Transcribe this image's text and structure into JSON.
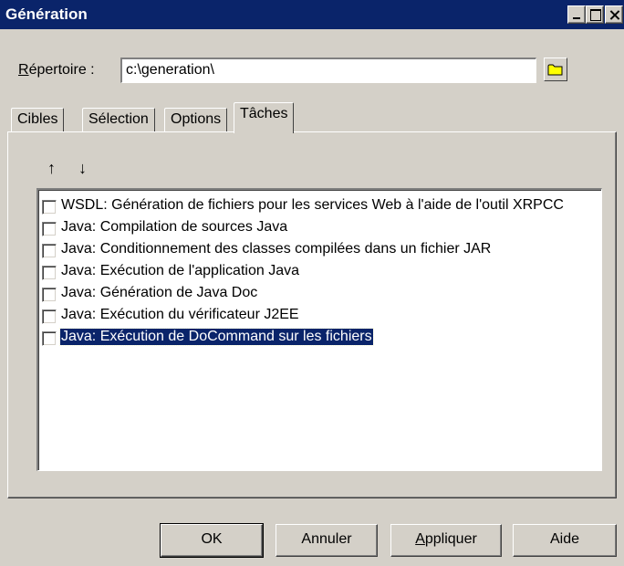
{
  "window": {
    "title": "Génération",
    "minimize_glyph": "",
    "maximize_glyph": "",
    "close_glyph": ""
  },
  "directory": {
    "label_mnemonic": "R",
    "label_rest": "épertoire :",
    "value": "c:\\generation\\",
    "browse_icon": "folder-icon"
  },
  "tabs": [
    {
      "label": "Cibles"
    },
    {
      "label": "Sélection"
    },
    {
      "label": "Options"
    },
    {
      "label": "Tâches",
      "active": true
    }
  ],
  "toolbar": {
    "move_up": "↑",
    "move_down": "↓"
  },
  "tasks": [
    {
      "label": "WSDL: Génération de fichiers pour les services Web à l'aide de l'outil XRPCC",
      "checked": false
    },
    {
      "label": "Java: Compilation de sources Java",
      "checked": false
    },
    {
      "label": "Java: Conditionnement des classes compilées dans un fichier JAR",
      "checked": false
    },
    {
      "label": "Java: Exécution de l'application Java",
      "checked": false
    },
    {
      "label": "Java: Génération de Java Doc",
      "checked": false
    },
    {
      "label": "Java: Exécution du vérificateur J2EE",
      "checked": false
    },
    {
      "label": "Java: Exécution de DoCommand sur les fichiers",
      "checked": false,
      "selected": true
    }
  ],
  "buttons": {
    "ok": "OK",
    "cancel": "Annuler",
    "apply_mnemonic": "A",
    "apply_rest": "ppliquer",
    "help": "Aide"
  },
  "colors": {
    "titlebar": "#0a246a",
    "face": "#d4d0c8",
    "selection": "#0a246a"
  }
}
